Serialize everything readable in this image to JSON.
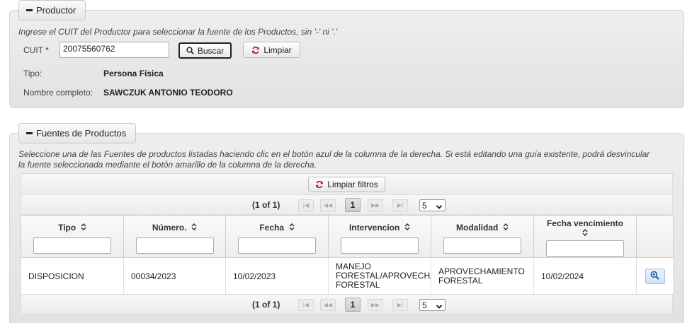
{
  "productor": {
    "legend": "Productor",
    "hint": "Ingrese el CUIT del Productor para seleccionar la fuente de los Productos, sin '-' ni '.'",
    "cuit_label": "CUIT *",
    "cuit_value": "20075560762",
    "buscar_label": "Buscar",
    "limpiar_label": "Limpiar",
    "tipo_label": "Tipo:",
    "tipo_value": "Persona Física",
    "nombre_label": "Nombre completo:",
    "nombre_value": "SAWCZUK ANTONIO TEODORO"
  },
  "fuentes": {
    "legend": "Fuentes de Productos",
    "hint_line1": "Seleccione una de las Fuentes de productos listadas haciendo clic en el botón azul de la columna de la derecha. Si está editando una guía existente, podrá desvincular",
    "hint_line2": "la fuente seleccionada mediante el botón amarillo de la columna de la derecha.",
    "limpiar_filtros_label": "Limpiar filtros",
    "pager": {
      "count": "(1 of 1)",
      "current_page": "1",
      "rows_per_page": "5"
    },
    "columns": [
      "Tipo",
      "Número.",
      "Fecha",
      "Intervencion",
      "Modalidad",
      "Fecha vencimiento"
    ],
    "rows": [
      {
        "tipo": "DISPOSICION",
        "numero": "00034/2023",
        "fecha": "10/02/2023",
        "intervencion": "MANEJO FORESTAL/APROVECHAMIENTO FORESTAL",
        "modalidad": "APROVECHAMIENTO FORESTAL",
        "vencimiento": "10/02/2024"
      }
    ]
  },
  "colors": {
    "panel_bg": "#e8e8e8",
    "refresh_icon": "#b0202e",
    "view_button": "#cfe3f5"
  },
  "icons": [
    "minus-icon",
    "search-icon",
    "refresh-icon",
    "sort-icon",
    "zoom-in-icon"
  ]
}
